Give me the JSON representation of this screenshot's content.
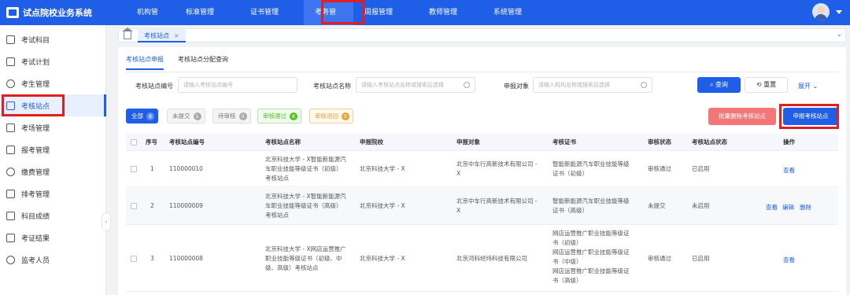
{
  "app": {
    "title": "试点院校业务系统"
  },
  "topnav": [
    {
      "label": "机构管理"
    },
    {
      "label": "标准管理"
    },
    {
      "label": "证书管理"
    },
    {
      "label": "考务管理"
    },
    {
      "label": "周报管理"
    },
    {
      "label": "教师管理"
    },
    {
      "label": "系统管理"
    }
  ],
  "sidebar": [
    {
      "label": "考试科目"
    },
    {
      "label": "考试计划"
    },
    {
      "label": "考生管理"
    },
    {
      "label": "考核站点"
    },
    {
      "label": "考场管理"
    },
    {
      "label": "报考管理"
    },
    {
      "label": "缴费管理"
    },
    {
      "label": "排考管理"
    },
    {
      "label": "科目成绩"
    },
    {
      "label": "考证结果"
    },
    {
      "label": "监考人员"
    }
  ],
  "open_tab": {
    "label": "考核站点",
    "close": "×"
  },
  "subtabs": [
    {
      "label": "考核站点申报"
    },
    {
      "label": "考核站点分配查询"
    }
  ],
  "filters": {
    "code_label": "考核站点编号",
    "code_placeholder": "请输入考核站点编号",
    "name_label": "考核站点名称",
    "name_placeholder": "请输入考核站点名称或搜索后选择",
    "target_label": "申报对象",
    "target_placeholder": "请输入机构名称或搜索后选择",
    "query": "查询",
    "reset": "重置",
    "expand": "展开"
  },
  "chips": [
    {
      "label": "全部",
      "count": "8"
    },
    {
      "label": "未提交",
      "count": "1"
    },
    {
      "label": "待审核",
      "count": "0"
    },
    {
      "label": "审核通过",
      "count": "8"
    },
    {
      "label": "审核退回",
      "count": "0"
    }
  ],
  "actions": {
    "batch_delete": "批量删除考核站点",
    "apply": "申报考核站点"
  },
  "table": {
    "columns": [
      "序号",
      "考核站点编号",
      "考核站点名称",
      "申报院校",
      "申报对象",
      "考核证书",
      "审核状态",
      "考核站点状态",
      "操作"
    ],
    "rows": [
      {
        "no": "1",
        "code": "110000010",
        "name": "北京科技大学 - X智能新能源汽\n车职业技能等级证书（初级）\n考核站点",
        "school": "北京科技大学 - X",
        "target": "北京中车行高新技术有限公司 -\nX",
        "cert": "智能新能源汽车职业技能等级\n证书（初级）",
        "audit": "审核通过",
        "status": "已启用",
        "ops": [
          "查看"
        ]
      },
      {
        "no": "2",
        "code": "110000009",
        "name": "北京科技大学 - X智能新能源汽\n车职业技能等级证书（高级）\n考核站点",
        "school": "北京科技大学 - X",
        "target": "北京中车行高新技术有限公司 -\nX",
        "cert": "智能新能源汽车职业技能等级\n证书（高级）",
        "audit": "未提交",
        "status": "未启用",
        "ops": [
          "查看",
          "编辑",
          "删除"
        ]
      },
      {
        "no": "3",
        "code": "110000008",
        "name": "北京科技大学 - X网店运营推广\n职业技能等级证书（初级、中\n级、高级）考核站点",
        "school": "北京科技大学 - X",
        "target": "北京鸿科经纬科技有限公司",
        "cert": "网店运营推广职业技能等级证\n书（初级）\n网店运营推广职业技能等级证\n书（中级）\n网店运营推广职业技能等级证\n书（高级）",
        "audit": "审核通过",
        "status": "已启用",
        "ops": [
          "查看"
        ]
      }
    ]
  }
}
